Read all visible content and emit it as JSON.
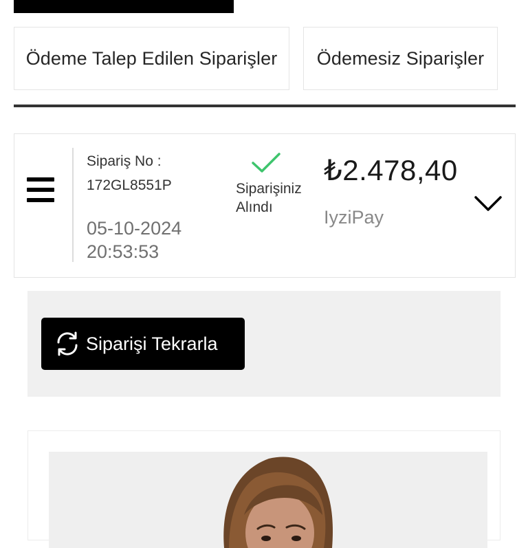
{
  "tabs": [
    {
      "label": "Ödeme Talep Edilen Siparişler"
    },
    {
      "label": "Ödemesiz Siparişler"
    }
  ],
  "order": {
    "order_no_label": "Sipariş No :",
    "order_no": "172GL8551P",
    "date": "05-10-2024",
    "time": "20:53:53",
    "status_line1": "Siparişiniz",
    "status_line2": "Alındı",
    "price": "₺2.478,40",
    "payment_method": "IyziPay"
  },
  "reorder": {
    "label": "Siparişi Tekrarla"
  },
  "icons": {
    "menu": "hamburger-menu-icon",
    "status": "checkmark-icon",
    "expand": "chevron-down-icon",
    "reorder": "refresh-icon"
  },
  "colors": {
    "status_check": "#3ec46d",
    "button_bg": "#000000",
    "panel_bg": "#f0f0f0"
  }
}
